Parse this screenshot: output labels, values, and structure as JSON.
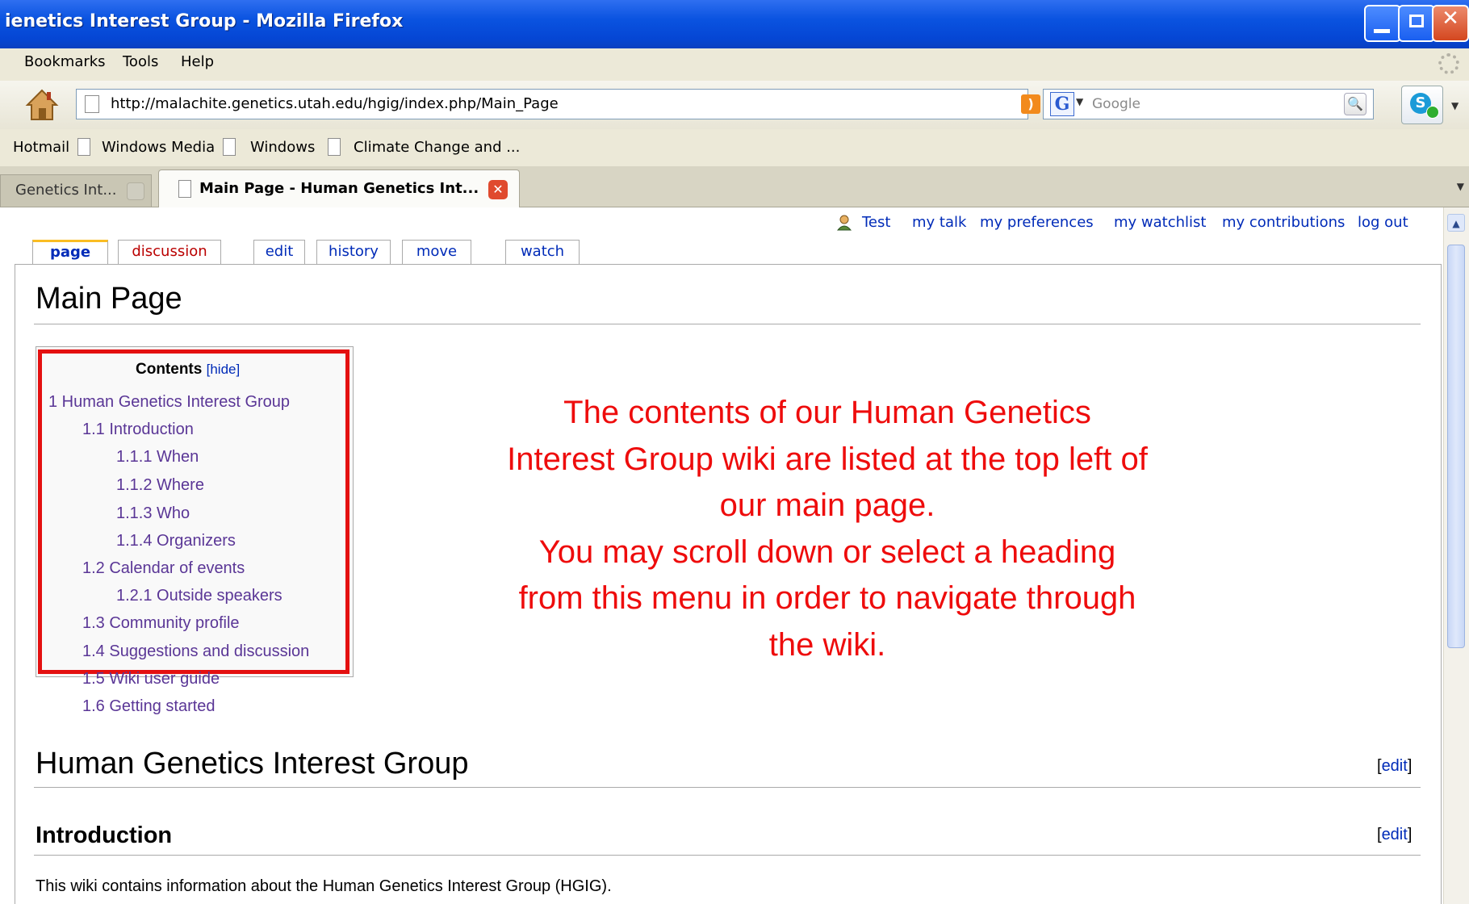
{
  "window": {
    "title": "ienetics Interest Group - Mozilla Firefox"
  },
  "menu": [
    "Bookmarks",
    "Tools",
    "Help"
  ],
  "nav": {
    "url": "http://malachite.genetics.utah.edu/hgig/index.php/Main_Page",
    "search_placeholder": "Google"
  },
  "bookmarks": [
    "Hotmail",
    "Windows Media",
    "Windows",
    "Climate Change and ..."
  ],
  "tabs": [
    {
      "label": "Genetics Int..."
    },
    {
      "label": "Main Page - Human Genetics Int..."
    }
  ],
  "wiki": {
    "user": "Test",
    "user_links": [
      "my talk",
      "my preferences",
      "my watchlist",
      "my contributions",
      "log out"
    ],
    "page_tabs": [
      "page",
      "discussion",
      "edit",
      "history",
      "move",
      "watch"
    ],
    "page_title": "Main Page",
    "toc": {
      "title": "Contents",
      "hide_label": "[hide]",
      "items": [
        "1 Human Genetics Interest Group",
        "1.1 Introduction",
        "1.1.1 When",
        "1.1.2 Where",
        "1.1.3 Who",
        "1.1.4 Organizers",
        "1.2 Calendar of events",
        "1.2.1 Outside speakers",
        "1.3 Community profile",
        "1.4 Suggestions and discussion",
        "1.5 Wiki user guide",
        "1.6 Getting started"
      ]
    },
    "annotation_lines": [
      "The contents of our Human Genetics",
      "Interest Group wiki are listed at the top left of",
      "our main page.",
      "You may scroll down or select a heading",
      "from this menu in order to navigate through",
      "the wiki."
    ],
    "section_heading": "Human Genetics Interest Group",
    "subsection_heading": "Introduction",
    "edit_label": "edit",
    "intro_text": "This wiki contains information about the Human Genetics Interest Group (HGIG)."
  },
  "colors": {
    "annotation": "#ee0c0c",
    "link": "#002bb8",
    "visited_link": "#5a3696",
    "highlight_box": "#e41010"
  }
}
